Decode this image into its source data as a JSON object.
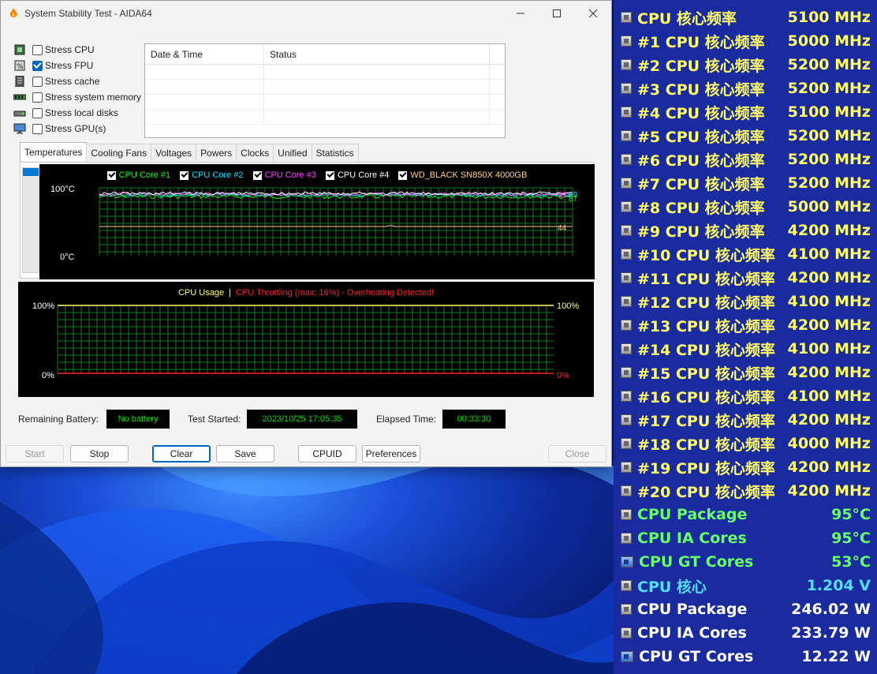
{
  "window": {
    "title": "System Stability Test - AIDA64",
    "controls": [
      "minimize",
      "maximize",
      "close"
    ]
  },
  "stress_options": [
    {
      "label": "Stress CPU",
      "checked": false,
      "icon": "cpu-icon"
    },
    {
      "label": "Stress FPU",
      "checked": true,
      "icon": "fpu-icon"
    },
    {
      "label": "Stress cache",
      "checked": false,
      "icon": "cache-icon"
    },
    {
      "label": "Stress system memory",
      "checked": false,
      "icon": "memory-icon"
    },
    {
      "label": "Stress local disks",
      "checked": false,
      "icon": "disk-icon"
    },
    {
      "label": "Stress GPU(s)",
      "checked": false,
      "icon": "monitor-icon"
    }
  ],
  "log_table": {
    "columns": [
      "Date & Time",
      "Status"
    ]
  },
  "tabs": [
    "Temperatures",
    "Cooling Fans",
    "Voltages",
    "Powers",
    "Clocks",
    "Unified",
    "Statistics"
  ],
  "active_tab": "Temperatures",
  "temp_graph": {
    "legend": [
      {
        "label": "CPU Core #1",
        "color": "#00ff00"
      },
      {
        "label": "CPU Core #2",
        "color": "#00e0ff"
      },
      {
        "label": "CPU Core #3",
        "color": "#ff40ff"
      },
      {
        "label": "CPU Core #4",
        "color": "#ffffff"
      },
      {
        "label": "WD_BLACK SN850X 4000GB",
        "color": "#ffd280"
      }
    ],
    "y_top_label": "100°C",
    "y_bottom_label": "0°C",
    "right_labels": {
      "high_a": "91",
      "high_b": "89",
      "high_c": "87",
      "low": "44"
    }
  },
  "usage_graph": {
    "title_a": "CPU Usage",
    "separator": "|",
    "title_b": "CPU Throttling (max: 16%) - Overheating Detected!",
    "left_top": "100%",
    "left_bottom": "0%",
    "right_top": "100%",
    "right_bottom": "0%"
  },
  "status": {
    "battery_label": "Remaining Battery:",
    "battery_value": "No battery",
    "started_label": "Test Started:",
    "started_value": "2023/10/25 17:05:35",
    "elapsed_label": "Elapsed Time:",
    "elapsed_value": "00:33:30"
  },
  "buttons": {
    "start": "Start",
    "stop": "Stop",
    "clear": "Clear",
    "save": "Save",
    "cpuid": "CPUID",
    "preferences": "Preferences",
    "close": "Close"
  },
  "osd": [
    {
      "label": "CPU 核心频率",
      "value": "5100 MHz",
      "color": "#ffff66",
      "icon": "chip-icon"
    },
    {
      "label": "#1 CPU 核心频率",
      "value": "5000 MHz",
      "color": "#ffff66",
      "icon": "chip-icon"
    },
    {
      "label": "#2 CPU 核心频率",
      "value": "5200 MHz",
      "color": "#ffff66",
      "icon": "chip-icon"
    },
    {
      "label": "#3 CPU 核心频率",
      "value": "5200 MHz",
      "color": "#ffff66",
      "icon": "chip-icon"
    },
    {
      "label": "#4 CPU 核心频率",
      "value": "5100 MHz",
      "color": "#ffff66",
      "icon": "chip-icon"
    },
    {
      "label": "#5 CPU 核心频率",
      "value": "5200 MHz",
      "color": "#ffff66",
      "icon": "chip-icon"
    },
    {
      "label": "#6 CPU 核心频率",
      "value": "5200 MHz",
      "color": "#ffff66",
      "icon": "chip-icon"
    },
    {
      "label": "#7 CPU 核心频率",
      "value": "5200 MHz",
      "color": "#ffff66",
      "icon": "chip-icon"
    },
    {
      "label": "#8 CPU 核心频率",
      "value": "5000 MHz",
      "color": "#ffff66",
      "icon": "chip-icon"
    },
    {
      "label": "#9 CPU 核心频率",
      "value": "4200 MHz",
      "color": "#ffff66",
      "icon": "chip-icon"
    },
    {
      "label": "#10 CPU 核心频率",
      "value": "4100 MHz",
      "color": "#ffff66",
      "icon": "chip-icon"
    },
    {
      "label": "#11 CPU 核心频率",
      "value": "4200 MHz",
      "color": "#ffff66",
      "icon": "chip-icon"
    },
    {
      "label": "#12 CPU 核心频率",
      "value": "4100 MHz",
      "color": "#ffff66",
      "icon": "chip-icon"
    },
    {
      "label": "#13 CPU 核心频率",
      "value": "4200 MHz",
      "color": "#ffff66",
      "icon": "chip-icon"
    },
    {
      "label": "#14 CPU 核心频率",
      "value": "4100 MHz",
      "color": "#ffff66",
      "icon": "chip-icon"
    },
    {
      "label": "#15 CPU 核心频率",
      "value": "4200 MHz",
      "color": "#ffff66",
      "icon": "chip-icon"
    },
    {
      "label": "#16 CPU 核心频率",
      "value": "4100 MHz",
      "color": "#ffff66",
      "icon": "chip-icon"
    },
    {
      "label": "#17 CPU 核心频率",
      "value": "4200 MHz",
      "color": "#ffff66",
      "icon": "chip-icon"
    },
    {
      "label": "#18 CPU 核心频率",
      "value": "4000 MHz",
      "color": "#ffff66",
      "icon": "chip-icon"
    },
    {
      "label": "#19 CPU 核心频率",
      "value": "4200 MHz",
      "color": "#ffff66",
      "icon": "chip-icon"
    },
    {
      "label": "#20 CPU 核心频率",
      "value": "4200 MHz",
      "color": "#ffff66",
      "icon": "chip-icon"
    },
    {
      "label": "CPU Package",
      "value": "95°C",
      "color": "#66ff66",
      "icon": "chip-icon"
    },
    {
      "label": "CPU IA Cores",
      "value": "95°C",
      "color": "#66ff66",
      "icon": "chip-icon"
    },
    {
      "label": "CPU GT Cores",
      "value": "53°C",
      "color": "#66ff66",
      "icon": "gpu-icon"
    },
    {
      "label": "CPU 核心",
      "value": "1.204 V",
      "color": "#55ddff",
      "icon": "chip-icon"
    },
    {
      "label": "CPU Package",
      "value": "246.02 W",
      "color": "#ffffff",
      "icon": "chip-icon"
    },
    {
      "label": "CPU IA Cores",
      "value": "233.79 W",
      "color": "#ffffff",
      "icon": "chip-icon"
    },
    {
      "label": "CPU GT Cores",
      "value": "12.22 W",
      "color": "#ffffff",
      "icon": "gpu-icon"
    }
  ]
}
